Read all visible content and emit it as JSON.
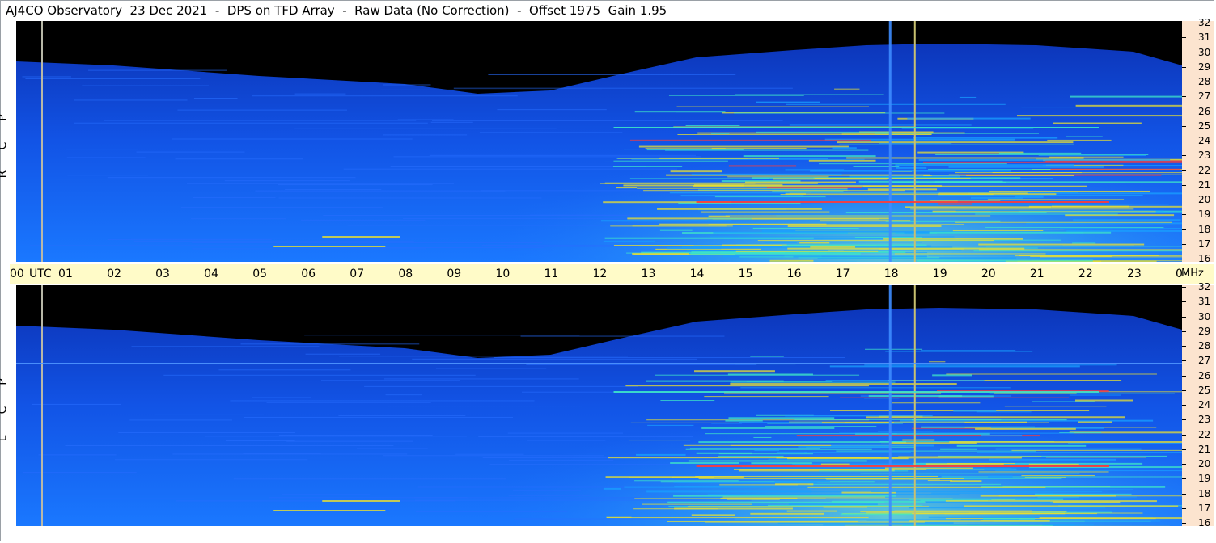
{
  "title": "AJ4CO Observatory  23 Dec 2021  -  DPS on TFD Array  -  Raw Data (No Correction)  -  Offset 1975  Gain 1.95",
  "panels": [
    {
      "id": "rcp",
      "label": [
        "R",
        "C",
        "P"
      ]
    },
    {
      "id": "lcp",
      "label": [
        "L",
        "C",
        "P"
      ]
    }
  ],
  "chart_data": {
    "type": "heatmap",
    "title": "AJ4CO Observatory  23 Dec 2021  -  DPS on TFD Array  -  Raw Data (No Correction)  -  Offset 1975  Gain 1.95",
    "x_unit": "UTC",
    "x_ticks": [
      "00",
      "01",
      "02",
      "03",
      "04",
      "05",
      "06",
      "07",
      "08",
      "09",
      "10",
      "11",
      "12",
      "13",
      "14",
      "15",
      "16",
      "17",
      "18",
      "19",
      "20",
      "21",
      "22",
      "23",
      "00"
    ],
    "y_unit": "MHz",
    "y_ticks": [
      32,
      31,
      30,
      29,
      28,
      27,
      26,
      25,
      24,
      23,
      22,
      21,
      20,
      19,
      18,
      17,
      16
    ],
    "ylim": [
      16,
      32
    ],
    "xlim_hours": [
      0,
      24
    ],
    "series": [
      {
        "name": "RCP"
      },
      {
        "name": "LCP"
      }
    ]
  },
  "axis": {
    "utc_label": "UTC",
    "mhz_label": "MHz"
  },
  "colors": {
    "background_black": "#000000",
    "low": "#0a3fd6",
    "mid": "#1aa0ff",
    "high": "#3de6c8",
    "peak": "#e8e030",
    "hot": "#ff3a3a",
    "time_axis_bg": "#fffbc8",
    "freq_axis_bg": "#fce4cf"
  }
}
